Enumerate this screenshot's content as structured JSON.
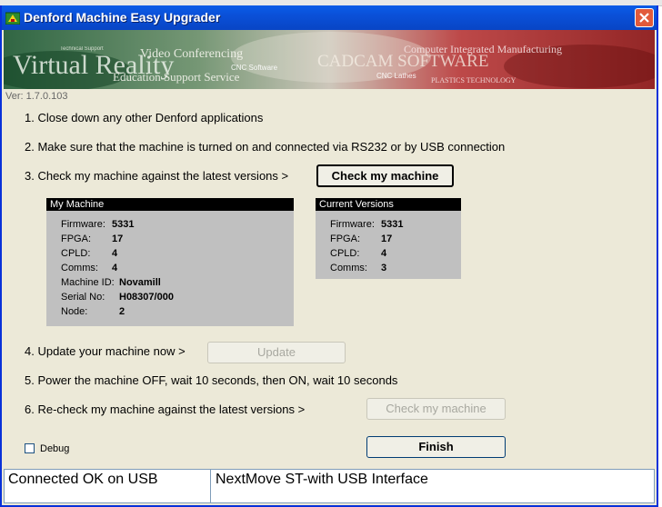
{
  "window": {
    "title": "Denford Machine Easy Upgrader",
    "version": "Ver: 1.7.0.103"
  },
  "steps": {
    "s1": "1. Close down any other Denford applications",
    "s2": "2. Make sure that the machine is turned on and connected via RS232 or by USB connection",
    "s3": "3. Check my machine against the latest versions >",
    "s4": "4. Update your machine now >",
    "s5": "5. Power the machine OFF, wait 10 seconds, then ON, wait 10 seconds",
    "s6": "6. Re-check my machine against the latest versions >"
  },
  "buttons": {
    "check": "Check my machine",
    "update": "Update",
    "recheck": "Check my machine",
    "finish": "Finish"
  },
  "my_machine": {
    "title": "My Machine",
    "rows": [
      {
        "label": "Firmware:",
        "value": "5331"
      },
      {
        "label": "FPGA:",
        "value": "17"
      },
      {
        "label": "CPLD:",
        "value": "4"
      },
      {
        "label": "Comms:",
        "value": "4"
      },
      {
        "label": "Machine ID:",
        "value": "Novamill"
      },
      {
        "label": "Serial No:",
        "value": "H08307/000"
      },
      {
        "label": "Node:",
        "value": "2"
      }
    ]
  },
  "current_versions": {
    "title": "Current Versions",
    "rows": [
      {
        "label": "Firmware:",
        "value": "5331"
      },
      {
        "label": "FPGA:",
        "value": "17"
      },
      {
        "label": "CPLD:",
        "value": "4"
      },
      {
        "label": "Comms:",
        "value": "3"
      }
    ]
  },
  "debug": {
    "label": "Debug",
    "checked": false
  },
  "status": {
    "left": "Connected OK on USB",
    "right": "NextMove ST-with USB Interface"
  },
  "banner": {
    "texts": [
      "Virtual Reality",
      "Video Conferencing",
      "Education Support Service",
      "Technical Support",
      "CNC Software",
      "CNC Lathes",
      "CADCAM SOFTWARE",
      "Computer Integrated Manufacturing",
      "PLASTICS TECHNOLOGY"
    ]
  }
}
